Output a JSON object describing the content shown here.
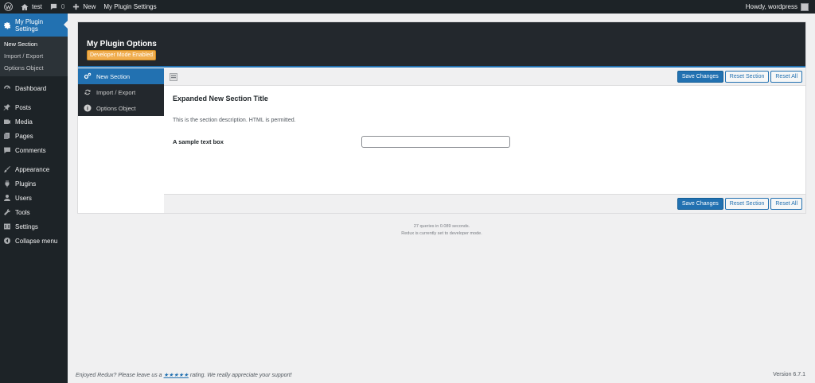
{
  "adminbar": {
    "site_name": "test",
    "comments_count": "0",
    "new_label": "New",
    "plugin_link": "My Plugin Settings",
    "howdy": "Howdy, wordpress"
  },
  "sidebar": {
    "current": "My Plugin Settings",
    "submenu": [
      "New Section",
      "Import / Export",
      "Options Object"
    ],
    "items": {
      "dashboard": "Dashboard",
      "posts": "Posts",
      "media": "Media",
      "pages": "Pages",
      "comments": "Comments",
      "appearance": "Appearance",
      "plugins": "Plugins",
      "users": "Users",
      "tools": "Tools",
      "settings": "Settings",
      "collapse": "Collapse menu"
    }
  },
  "panel": {
    "title": "My Plugin Options",
    "badge": "Developer Mode Enabled",
    "nav": [
      "New Section",
      "Import / Export",
      "Options Object"
    ],
    "buttons": {
      "save": "Save Changes",
      "reset_section": "Reset Section",
      "reset_all": "Reset All"
    },
    "section": {
      "title": "Expanded New Section Title",
      "description": "This is the section description. HTML is permitted.",
      "field_label": "A sample text box",
      "field_value": ""
    }
  },
  "stats": {
    "queries": "27 queries in 0.089 seconds.",
    "mode": "Redux is currently set to developer mode."
  },
  "footer": {
    "thanks_before": "Enjoyed Redux? Please leave us a ",
    "stars": "★★★★★",
    "thanks_after": " rating. We really appreciate your support!",
    "version": "Version 6.7.1"
  },
  "colors": {
    "accent": "#2271b1",
    "admin_dark": "#1d2327",
    "badge": "#f0ad4e"
  }
}
